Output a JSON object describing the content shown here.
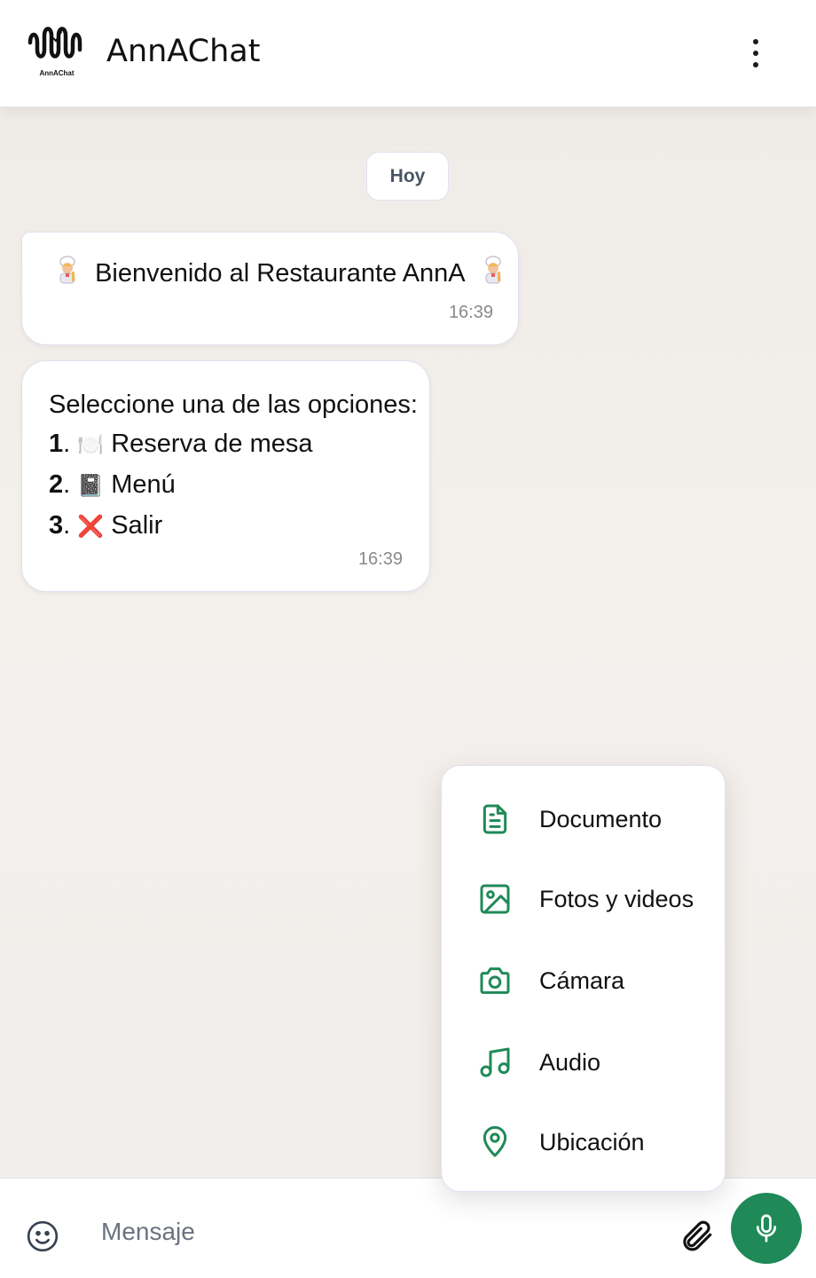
{
  "header": {
    "logo_text": "AnnAChat",
    "title": "AnnAChat",
    "menu_icon": "kebab-menu-icon"
  },
  "chat": {
    "date_separator": "Hoy",
    "messages": [
      {
        "text": "Bienvenido al Restaurante AnnA",
        "emoji": "chef-emoji",
        "time": "16:39"
      },
      {
        "intro": "Seleccione una de las opciones:",
        "options": [
          {
            "num": "1",
            "emoji": "🍽️",
            "label": "Reserva de mesa"
          },
          {
            "num": "2",
            "emoji": "📓",
            "label": "Menú"
          },
          {
            "num": "3",
            "emoji": "❌",
            "label": "Salir"
          }
        ],
        "time": "16:39"
      }
    ]
  },
  "attach_menu": {
    "accent_color": "#1f8a57",
    "items": [
      {
        "label": "Documento",
        "icon": "document-icon"
      },
      {
        "label": "Fotos y videos",
        "icon": "image-icon"
      },
      {
        "label": "Cámara",
        "icon": "camera-icon"
      },
      {
        "label": "Audio",
        "icon": "music-note-icon"
      },
      {
        "label": "Ubicación",
        "icon": "location-pin-icon"
      }
    ]
  },
  "composer": {
    "placeholder": "Mensaje",
    "emoji_icon": "smiley-icon",
    "attach_icon": "paperclip-icon",
    "mic_icon": "microphone-icon",
    "mic_color": "#1f8a57"
  }
}
